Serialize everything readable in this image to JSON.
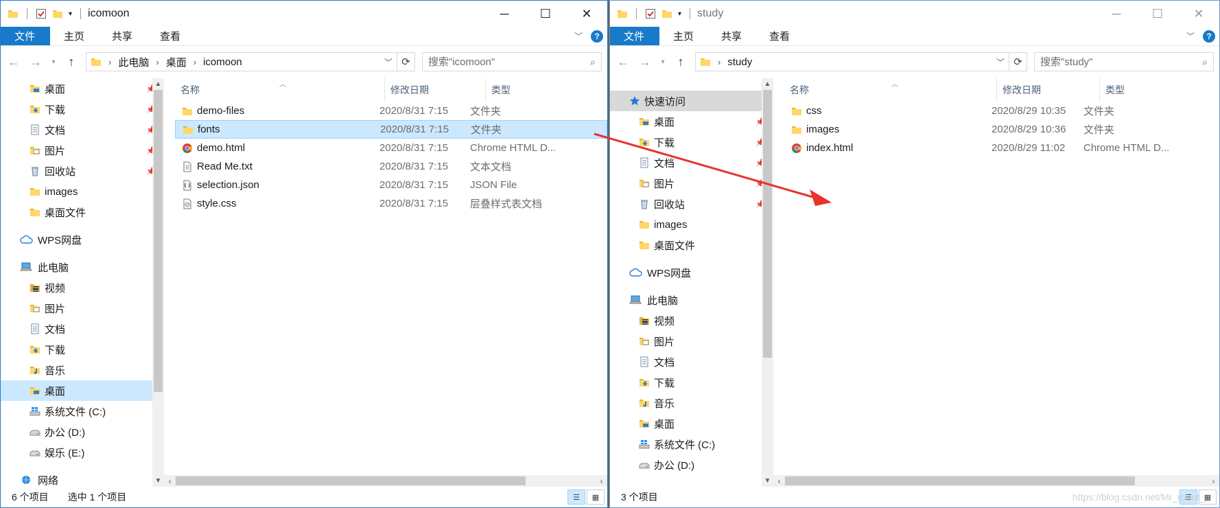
{
  "left": {
    "title": "icomoon",
    "ribbon_tabs": [
      "文件",
      "主页",
      "共享",
      "查看"
    ],
    "path": [
      "此电脑",
      "桌面",
      "icomoon"
    ],
    "search_placeholder": "搜索\"icomoon\"",
    "nav": [
      {
        "label": "桌面",
        "icon": "desktop-folder",
        "pin": true
      },
      {
        "label": "下载",
        "icon": "download-folder",
        "pin": true
      },
      {
        "label": "文档",
        "icon": "documents-folder",
        "pin": true
      },
      {
        "label": "图片",
        "icon": "pictures-folder",
        "pin": true
      },
      {
        "label": "回收站",
        "icon": "recycle-bin",
        "pin": true
      },
      {
        "label": "images",
        "icon": "folder",
        "pin": false
      },
      {
        "label": "桌面文件",
        "icon": "folder",
        "pin": false
      },
      {
        "label": "WPS网盘",
        "icon": "cloud",
        "level": 0
      },
      {
        "label": "此电脑",
        "icon": "computer",
        "level": 0
      },
      {
        "label": "视频",
        "icon": "video-folder"
      },
      {
        "label": "图片",
        "icon": "pictures-folder"
      },
      {
        "label": "文档",
        "icon": "documents-folder"
      },
      {
        "label": "下载",
        "icon": "download-folder"
      },
      {
        "label": "音乐",
        "icon": "music-folder"
      },
      {
        "label": "桌面",
        "icon": "desktop-folder",
        "selected": true
      },
      {
        "label": "系统文件 (C:)",
        "icon": "windows-drive"
      },
      {
        "label": "办公 (D:)",
        "icon": "drive"
      },
      {
        "label": "娱乐 (E:)",
        "icon": "drive"
      },
      {
        "label": "网络",
        "icon": "network",
        "level": 0
      }
    ],
    "columns": {
      "name": "名称",
      "date": "修改日期",
      "type": "类型"
    },
    "files": [
      {
        "name": "demo-files",
        "date": "2020/8/31 7:15",
        "type": "文件夹",
        "icon": "folder"
      },
      {
        "name": "fonts",
        "date": "2020/8/31 7:15",
        "type": "文件夹",
        "icon": "folder",
        "selected": true
      },
      {
        "name": "demo.html",
        "date": "2020/8/31 7:15",
        "type": "Chrome HTML D...",
        "icon": "chrome"
      },
      {
        "name": "Read Me.txt",
        "date": "2020/8/31 7:15",
        "type": "文本文档",
        "icon": "text-file"
      },
      {
        "name": "selection.json",
        "date": "2020/8/31 7:15",
        "type": "JSON File",
        "icon": "json-file"
      },
      {
        "name": "style.css",
        "date": "2020/8/31 7:15",
        "type": "层叠样式表文档",
        "icon": "css-file"
      }
    ],
    "status_count": "6 个项目",
    "status_selected": "选中 1 个项目"
  },
  "right": {
    "title": "study",
    "ribbon_tabs": [
      "文件",
      "主页",
      "共享",
      "查看"
    ],
    "path": [
      "study"
    ],
    "search_placeholder": "搜索\"study\"",
    "nav": [
      {
        "label": "快速访问",
        "icon": "star",
        "level": 0,
        "header": true
      },
      {
        "label": "桌面",
        "icon": "desktop-folder",
        "pin": true
      },
      {
        "label": "下载",
        "icon": "download-folder",
        "pin": true
      },
      {
        "label": "文档",
        "icon": "documents-folder",
        "pin": true
      },
      {
        "label": "图片",
        "icon": "pictures-folder",
        "pin": true
      },
      {
        "label": "回收站",
        "icon": "recycle-bin",
        "pin": true
      },
      {
        "label": "images",
        "icon": "folder",
        "pin": false
      },
      {
        "label": "桌面文件",
        "icon": "folder",
        "pin": false
      },
      {
        "label": "WPS网盘",
        "icon": "cloud",
        "level": 0
      },
      {
        "label": "此电脑",
        "icon": "computer",
        "level": 0
      },
      {
        "label": "视频",
        "icon": "video-folder"
      },
      {
        "label": "图片",
        "icon": "pictures-folder"
      },
      {
        "label": "文档",
        "icon": "documents-folder"
      },
      {
        "label": "下载",
        "icon": "download-folder"
      },
      {
        "label": "音乐",
        "icon": "music-folder"
      },
      {
        "label": "桌面",
        "icon": "desktop-folder"
      },
      {
        "label": "系统文件 (C:)",
        "icon": "windows-drive"
      },
      {
        "label": "办公 (D:)",
        "icon": "drive"
      }
    ],
    "columns": {
      "name": "名称",
      "date": "修改日期",
      "type": "类型"
    },
    "files": [
      {
        "name": "css",
        "date": "2020/8/29 10:35",
        "type": "文件夹",
        "icon": "folder"
      },
      {
        "name": "images",
        "date": "2020/8/29 10:36",
        "type": "文件夹",
        "icon": "folder"
      },
      {
        "name": "index.html",
        "date": "2020/8/29 11:02",
        "type": "Chrome HTML D...",
        "icon": "chrome"
      }
    ],
    "status_count": "3 个项目"
  },
  "watermark": "https://blog.csdn.net/Mr_robot_",
  "colors": {
    "accent": "#1979ca",
    "selection": "#cce8ff",
    "arrow": "#e8322c",
    "folder": "#f5c243"
  }
}
